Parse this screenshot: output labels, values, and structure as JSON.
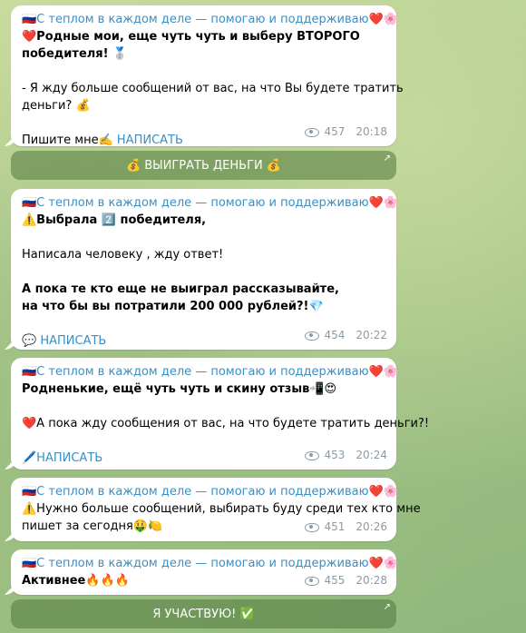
{
  "messages": [
    {
      "sender": "🇷🇺С теплом в каждом деле — помогаю и поддерживаю❤️🌸",
      "lines": [
        "❤️Родные мои, еще чуть чуть и выберу ВТОРОГО",
        "победителя! 🥈",
        "",
        "- Я жду больше сообщений от вас, на что Вы будете тратить",
        "деньги? 💰",
        "",
        "Пишите мне✍️"
      ],
      "link": "НАПИСАТЬ",
      "views": "457",
      "time": "20:18"
    },
    {
      "sender": "🇷🇺С теплом в каждом деле — помогаю и поддерживаю❤️🌸",
      "lines": [
        "⚠️Выбрала 2️⃣ победителя,",
        "",
        "Написала человеку , жду ответ!",
        "",
        " А пока те кто еще не выиграл рассказывайте,",
        "на что бы вы потратили 200 000 рублей?!💎"
      ],
      "link": "💬 НАПИСАТЬ",
      "views": "454",
      "time": "20:22"
    },
    {
      "sender": "🇷🇺С теплом в каждом деле — помогаю и поддерживаю❤️🌸",
      "lines": [
        "Родненькие, ещё чуть чуть и скину отзыв📲😍",
        "",
        "❤️А пока жду сообщения от вас, на что будете тратить деньги?!"
      ],
      "link": "🖊️НАПИСАТЬ",
      "views": "453",
      "time": "20:24"
    },
    {
      "sender": "🇷🇺С теплом в каждом деле — помогаю и поддерживаю❤️🌸",
      "lines": [
        "⚠️Нужно больше сообщений, выбирать буду среди тех кто мне",
        "пишет за сегодня🤑🍋"
      ],
      "views": "451",
      "time": "20:26"
    },
    {
      "sender": "🇷🇺С теплом в каждом деле — помогаю и поддерживаю❤️🌸",
      "lines": [
        "Активнее🔥🔥🔥"
      ],
      "views": "455",
      "time": "20:28"
    }
  ],
  "buttons": {
    "win_money": "💰 ВЫИГРАТЬ ДЕНЬГИ 💰",
    "participate": "Я УЧАСТВУЮ! ✅"
  }
}
